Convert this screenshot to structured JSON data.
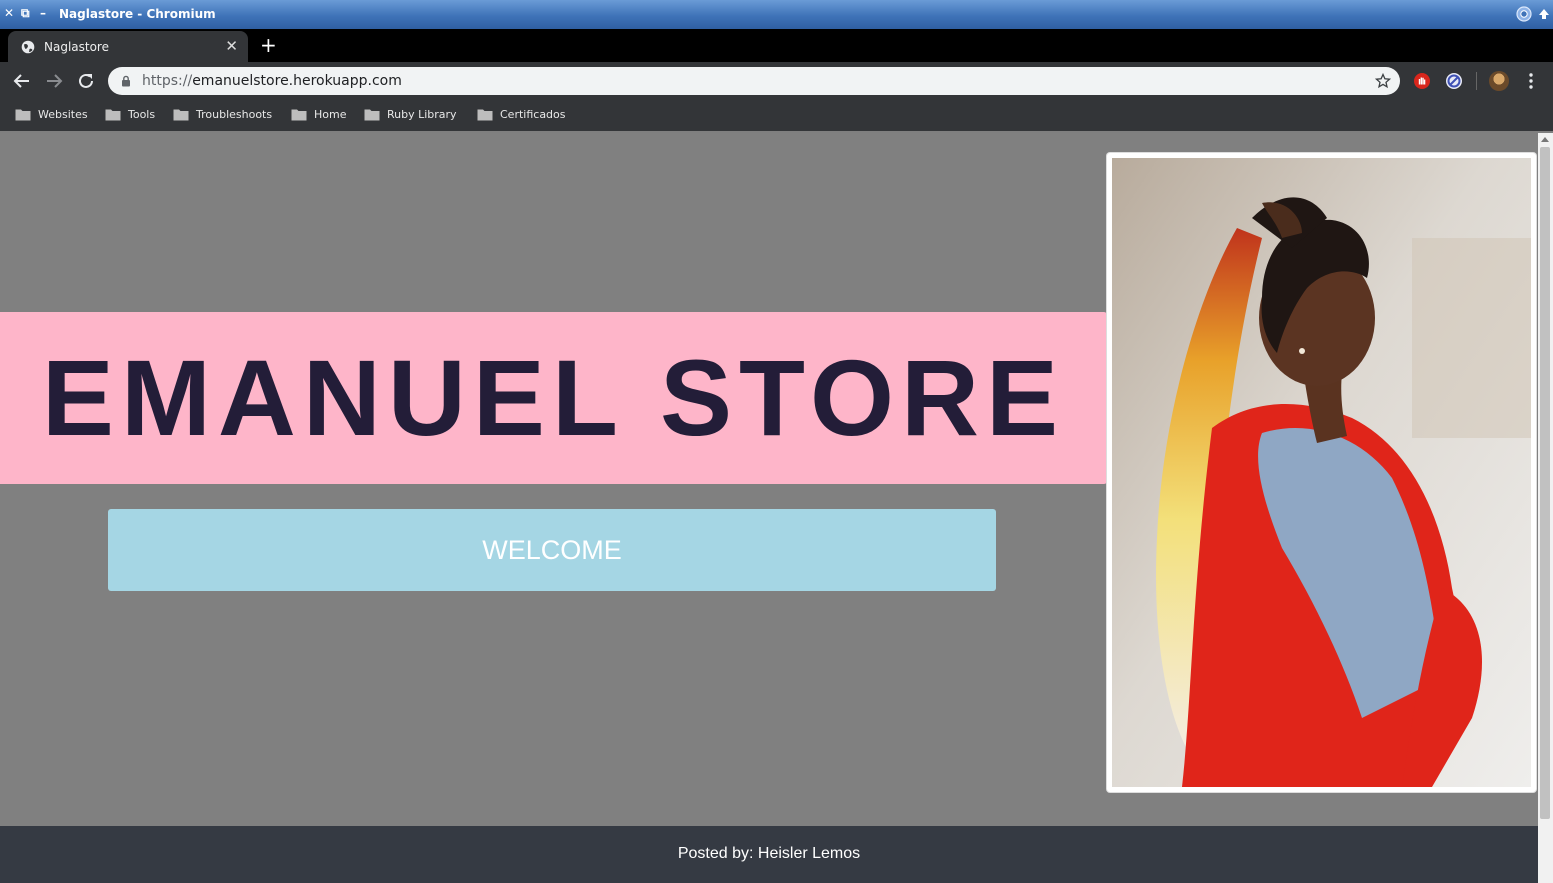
{
  "window": {
    "title": "Naglastore - Chromium",
    "close_glyph": "✕",
    "restore_glyph": "⧉",
    "minimize_glyph": "–"
  },
  "tab": {
    "label": "Naglastore",
    "close_glyph": "✕",
    "new_tab_glyph": "+"
  },
  "toolbar": {
    "url_scheme": "https://",
    "url_host": "emanuelstore.herokuapp.com",
    "icons": [
      "back-arrow-icon",
      "forward-arrow-icon",
      "reload-icon",
      "lock-icon",
      "star-icon",
      "extension-stop-icon",
      "extension-block-icon",
      "profile-avatar",
      "kebab-menu-icon"
    ]
  },
  "bookmarks": [
    {
      "label": "Websites"
    },
    {
      "label": "Tools"
    },
    {
      "label": "Troubleshoots"
    },
    {
      "label": "Home"
    },
    {
      "label": "Ruby Library"
    },
    {
      "label": "Certificados"
    }
  ],
  "page": {
    "heading": "EMANUEL STORE",
    "welcome_label": "WELCOME",
    "footer_text": "Posted by: Heisler Lemos",
    "colors": {
      "background": "#808080",
      "banner": "#feb5c9",
      "heading_text": "#231d38",
      "welcome_bg": "#a5d6e4",
      "footer_bg": "#353a43"
    }
  }
}
